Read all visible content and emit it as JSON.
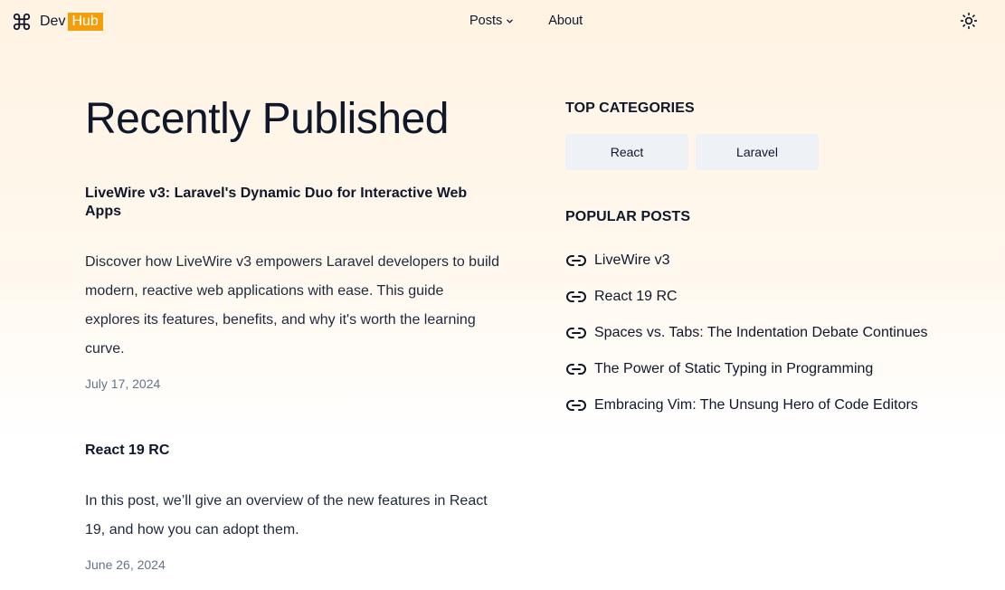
{
  "header": {
    "logo_dev": "Dev",
    "logo_hub": "Hub",
    "nav": {
      "posts": "Posts",
      "about": "About"
    }
  },
  "main": {
    "title": "Recently Published",
    "posts": [
      {
        "title": "LiveWire v3: Laravel's Dynamic Duo for Interactive Web Apps",
        "excerpt": "Discover how LiveWire v3 empowers Laravel developers to build modern, reactive web applications with ease. This guide explores its features, benefits, and why it's worth the learning curve.",
        "date": "July 17, 2024"
      },
      {
        "title": "React 19 RC",
        "excerpt": "In this post, we’ll give an overview of the new features in React 19, and how you can adopt them.",
        "date": "June 26, 2024"
      }
    ]
  },
  "sidebar": {
    "categories_heading": "TOP CATEGORIES",
    "categories": [
      "React",
      "Laravel"
    ],
    "popular_heading": "POPULAR POSTS",
    "popular": [
      "LiveWire v3",
      "React 19 RC",
      "Spaces vs. Tabs: The Indentation Debate Continues",
      "The Power of Static Typing in Programming",
      "Embracing Vim: The Unsung Hero of Code Editors"
    ]
  },
  "colors": {
    "accent": "#f59e0b",
    "text": "#0f172a",
    "muted": "#64748b",
    "chip_bg": "#eef1f6"
  },
  "icons": [
    "command-icon",
    "chevron-down-icon",
    "sun-icon",
    "link-icon"
  ]
}
